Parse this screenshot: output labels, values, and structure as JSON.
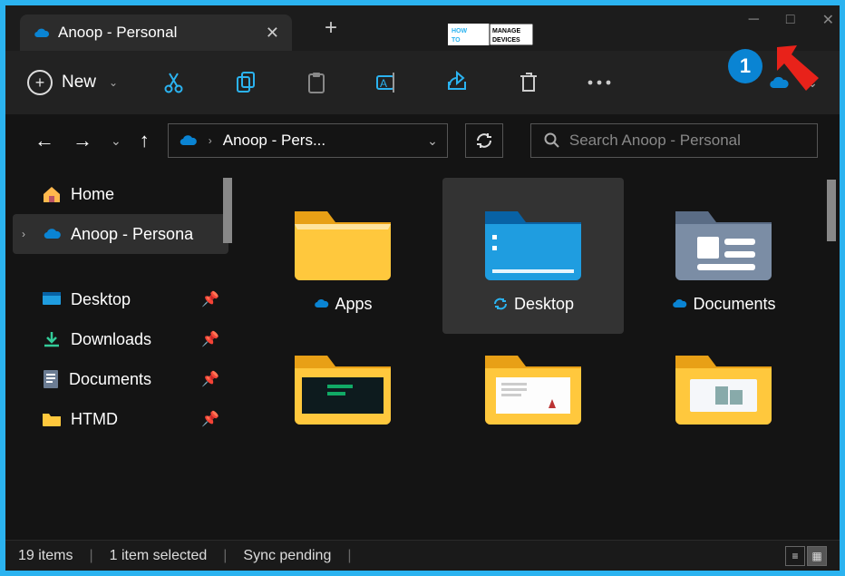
{
  "titlebar": {
    "tab_title": "Anoop - Personal",
    "add_tab": "+",
    "minimize": "─",
    "maximize": "□",
    "close": "✕"
  },
  "toolbar": {
    "new_label": "New"
  },
  "nav": {
    "location": "Anoop - Pers...",
    "search_placeholder": "Search Anoop - Personal"
  },
  "sidebar": {
    "home": "Home",
    "onedrive": "Anoop - Persona",
    "desktop": "Desktop",
    "downloads": "Downloads",
    "documents": "Documents",
    "htmd": "HTMD"
  },
  "files": {
    "apps": "Apps",
    "desktop": "Desktop",
    "documents": "Documents"
  },
  "status": {
    "items": "19 items",
    "selected": "1 item selected",
    "sync": "Sync pending"
  },
  "annotation": {
    "badge": "1"
  },
  "colors": {
    "accent": "#2bb3f0",
    "folder": "#ffc83d",
    "dark": "#141414"
  }
}
